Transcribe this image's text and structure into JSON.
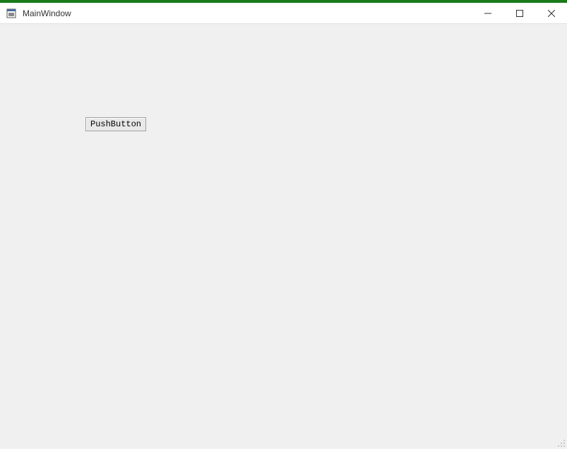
{
  "window": {
    "title": "MainWindow"
  },
  "client": {
    "push_button_label": "PushButton"
  }
}
